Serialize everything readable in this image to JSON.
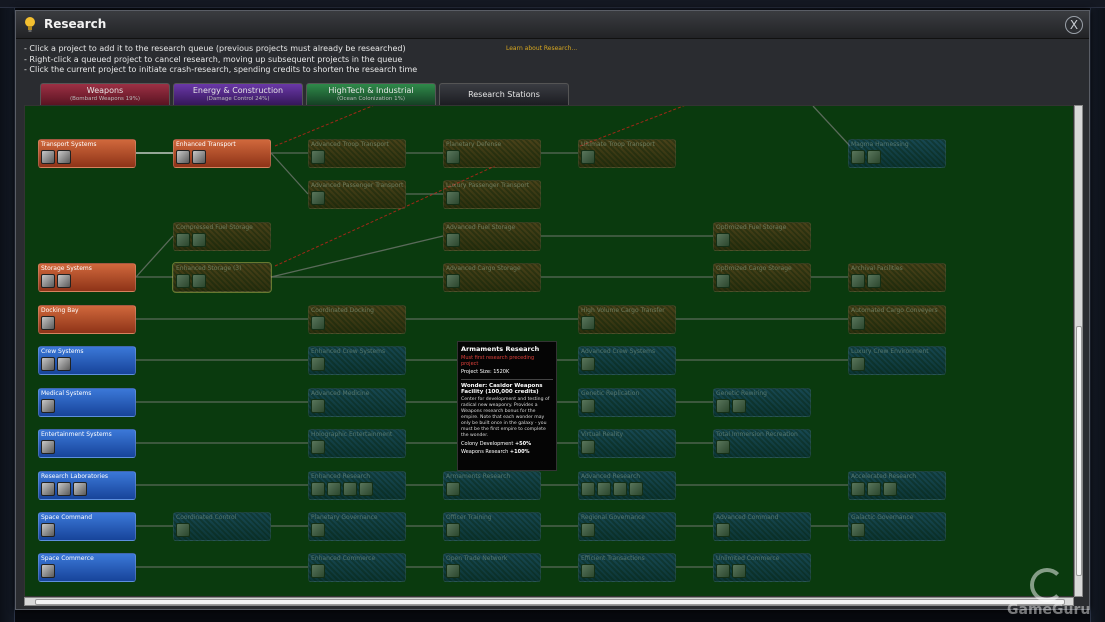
{
  "window": {
    "title": "Research",
    "close_label": "X"
  },
  "instructions": [
    "- Click a project to add it to the research queue (previous projects must already be researched)",
    "- Right-click a queued project to cancel research, moving up subsequent projects in the queue",
    "- Click the current project to initiate crash-research, spending credits to shorten the research time"
  ],
  "learn_link": "Learn about Research...",
  "tabs": [
    {
      "label": "Weapons",
      "sub": "(Bombard Weapons 19%)"
    },
    {
      "label": "Energy & Construction",
      "sub": "(Damage Control 24%)"
    },
    {
      "label": "HighTech & Industrial",
      "sub": "(Ocean Colonization 1%)"
    },
    {
      "label": "Research Stations",
      "sub": ""
    }
  ],
  "nodes": [
    {
      "label": "Transport Systems",
      "color": "orange",
      "dim": false,
      "icons": 2
    },
    {
      "label": "Enhanced Transport",
      "color": "orange",
      "dim": false,
      "icons": 2
    },
    {
      "label": "Advanced Troop Transport",
      "color": "orange",
      "dim": true,
      "icons": 1
    },
    {
      "label": "Advanced Passenger Transport",
      "color": "orange",
      "dim": true,
      "icons": 1
    },
    {
      "label": "Planetary Defense",
      "color": "orange",
      "dim": true,
      "icons": 1
    },
    {
      "label": "Luxury Passenger Transport",
      "color": "orange",
      "dim": true,
      "icons": 1
    },
    {
      "label": "Ultimate Troop Transport",
      "color": "orange",
      "dim": true,
      "icons": 1
    },
    {
      "label": "Magma Harnessing",
      "color": "blue",
      "dim": true,
      "icons": 2
    },
    {
      "label": "Compressed Fuel Storage",
      "color": "orange",
      "dim": true,
      "icons": 2
    },
    {
      "label": "Advanced Fuel Storage",
      "color": "orange",
      "dim": true,
      "icons": 1
    },
    {
      "label": "Optimized Fuel Storage",
      "color": "orange",
      "dim": true,
      "icons": 1
    },
    {
      "label": "Storage Systems",
      "color": "orange",
      "dim": false,
      "icons": 2
    },
    {
      "label": "Enhanced Storage (3)",
      "color": "orange",
      "dim": true,
      "icons": 2
    },
    {
      "label": "Advanced Cargo Storage",
      "color": "orange",
      "dim": true,
      "icons": 1
    },
    {
      "label": "Optimized Cargo Storage",
      "color": "orange",
      "dim": true,
      "icons": 1
    },
    {
      "label": "Archival Facilities",
      "color": "orange",
      "dim": true,
      "icons": 2
    },
    {
      "label": "Docking Bay",
      "color": "orange",
      "dim": false,
      "icons": 1
    },
    {
      "label": "Coordinated Docking",
      "color": "orange",
      "dim": true,
      "icons": 1
    },
    {
      "label": "High Volume Cargo Transfer",
      "color": "orange",
      "dim": true,
      "icons": 1
    },
    {
      "label": "Automated Cargo Conveyers",
      "color": "orange",
      "dim": true,
      "icons": 1
    },
    {
      "label": "Crew Systems",
      "color": "blue",
      "dim": false,
      "icons": 2
    },
    {
      "label": "Enhanced Crew Systems",
      "color": "blue",
      "dim": true,
      "icons": 1
    },
    {
      "label": "Advanced Crew Systems",
      "color": "blue",
      "dim": true,
      "icons": 1
    },
    {
      "label": "Luxury Crew Environment",
      "color": "blue",
      "dim": true,
      "icons": 1
    },
    {
      "label": "Medical Systems",
      "color": "blue",
      "dim": false,
      "icons": 1
    },
    {
      "label": "Advanced Medicine",
      "color": "blue",
      "dim": true,
      "icons": 1
    },
    {
      "label": "Genetic Replication",
      "color": "blue",
      "dim": true,
      "icons": 1
    },
    {
      "label": "Genetic Rewiring",
      "color": "blue",
      "dim": true,
      "icons": 2
    },
    {
      "label": "Entertainment Systems",
      "color": "blue",
      "dim": false,
      "icons": 1
    },
    {
      "label": "Holographic Entertainment",
      "color": "blue",
      "dim": true,
      "icons": 1
    },
    {
      "label": "Virtual Reality",
      "color": "blue",
      "dim": true,
      "icons": 1
    },
    {
      "label": "Total Immersion Recreation",
      "color": "blue",
      "dim": true,
      "icons": 1
    },
    {
      "label": "Research Laboratories",
      "color": "blue",
      "dim": false,
      "icons": 3
    },
    {
      "label": "Enhanced Research",
      "color": "blue",
      "dim": true,
      "icons": 4
    },
    {
      "label": "Armaments Research",
      "color": "blue",
      "dim": true,
      "icons": 1
    },
    {
      "label": "Advanced Research",
      "color": "blue",
      "dim": true,
      "icons": 4
    },
    {
      "label": "Accelerated Research",
      "color": "blue",
      "dim": true,
      "icons": 3
    },
    {
      "label": "Space Command",
      "color": "blue",
      "dim": false,
      "icons": 1
    },
    {
      "label": "Coordinated Control",
      "color": "blue",
      "dim": true,
      "icons": 1
    },
    {
      "label": "Planetary Governance",
      "color": "blue",
      "dim": true,
      "icons": 1
    },
    {
      "label": "Officer Training",
      "color": "blue",
      "dim": true,
      "icons": 1
    },
    {
      "label": "Regional Governance",
      "color": "blue",
      "dim": true,
      "icons": 1
    },
    {
      "label": "Advanced Command",
      "color": "blue",
      "dim": true,
      "icons": 1
    },
    {
      "label": "Galactic Governance",
      "color": "blue",
      "dim": true,
      "icons": 1
    },
    {
      "label": "Space Commerce",
      "color": "blue",
      "dim": false,
      "icons": 1
    },
    {
      "label": "Enhanced Commerce",
      "color": "blue",
      "dim": true,
      "icons": 1
    },
    {
      "label": "Open Trade Network",
      "color": "blue",
      "dim": true,
      "icons": 1
    },
    {
      "label": "Efficient Transactions",
      "color": "blue",
      "dim": true,
      "icons": 1
    },
    {
      "label": "Unlimited Commerce",
      "color": "blue",
      "dim": true,
      "icons": 2
    }
  ],
  "tooltip": {
    "title": "Armaments Research",
    "warning": "Must first research preceding project",
    "size": "Project Size: 1520K",
    "wonder": "Wonder: Casidor Weapons Facility (100,000 credits)",
    "desc": "Center for development and testing of radical new weaponry. Provides a Weapons research bonus for the empire. Note that each wonder may only be built once in the galaxy - you must be the first empire to complete the wonder.",
    "bonus1_label": "Colony Development",
    "bonus1_value": "+50%",
    "bonus2_label": "Weapons Research",
    "bonus2_value": "+100%"
  },
  "watermark": "GameGuru"
}
